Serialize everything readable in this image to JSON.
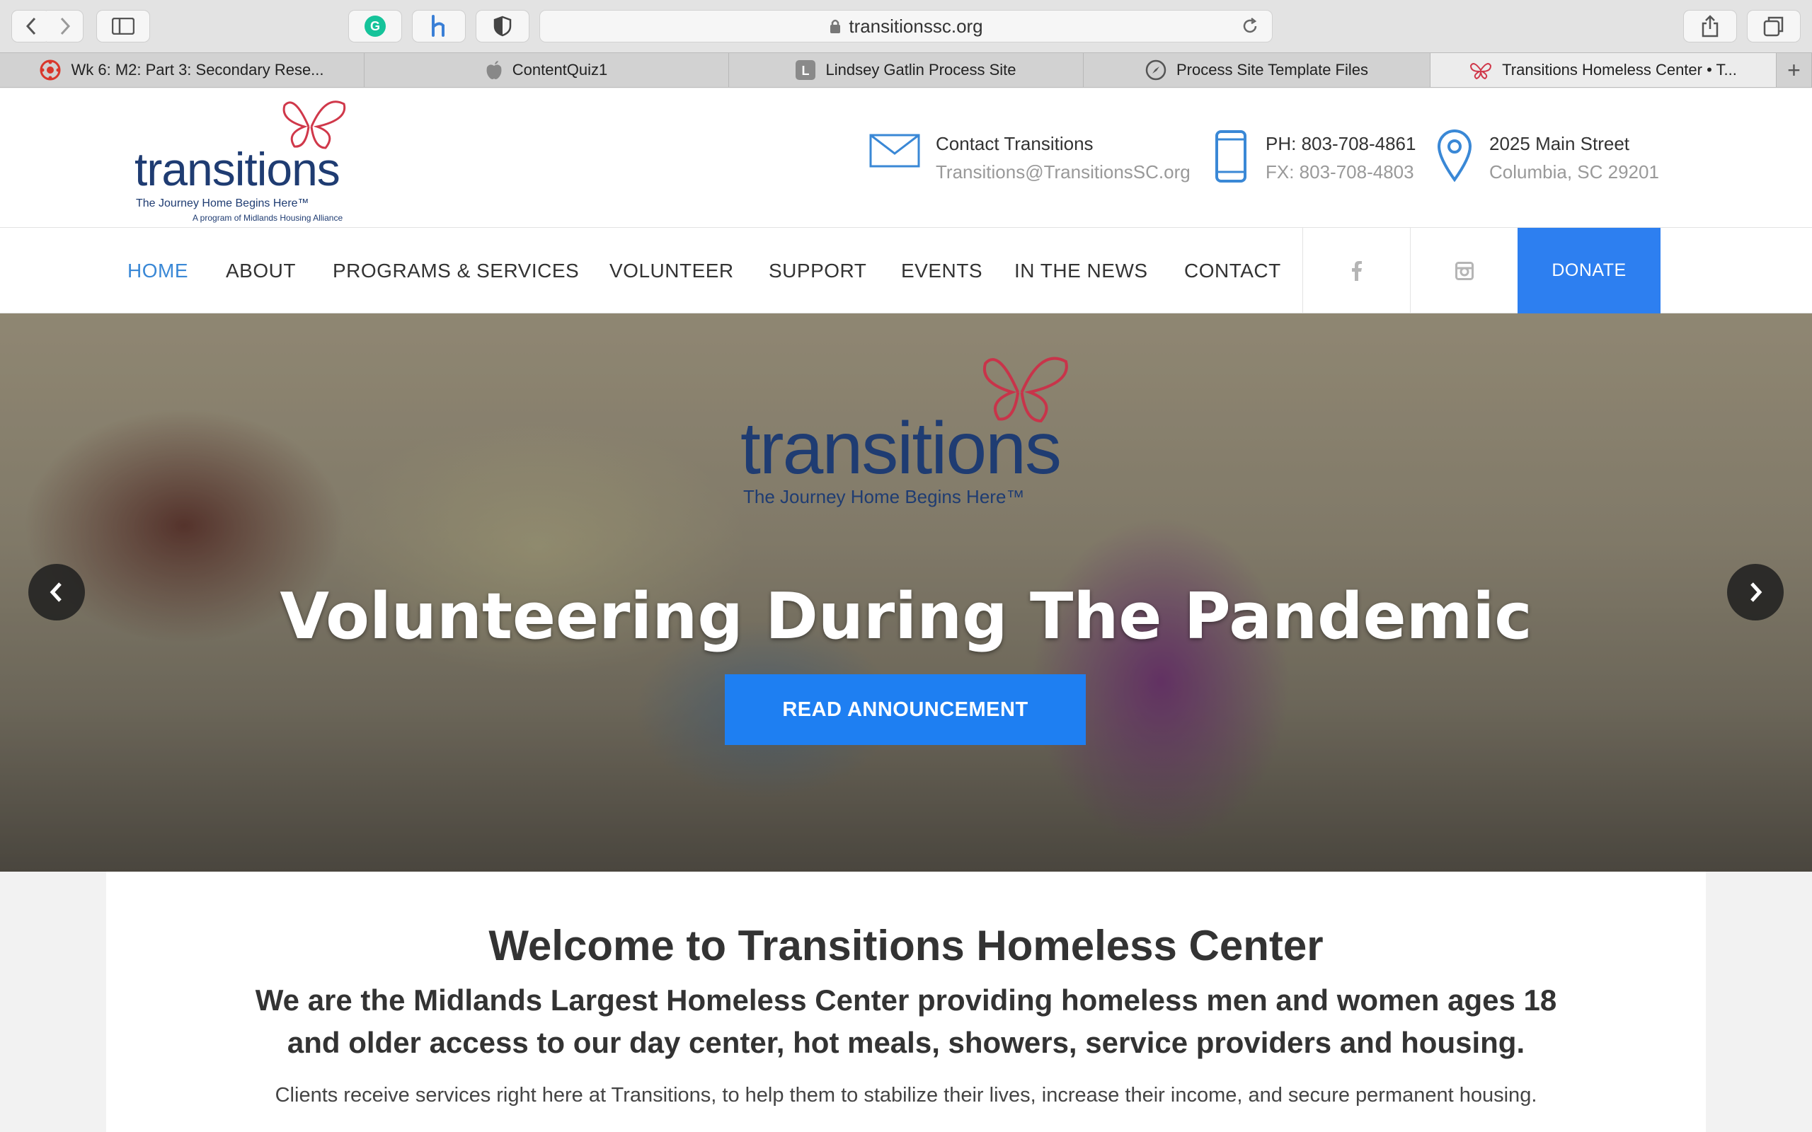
{
  "browser": {
    "url": "transitionssc.org",
    "tabs": [
      {
        "label": "Wk 6: M2: Part 3: Secondary Rese...",
        "icon": "canvas-icon",
        "active": false
      },
      {
        "label": "ContentQuiz1",
        "icon": "apple-icon",
        "active": false
      },
      {
        "label": "Lindsey Gatlin Process Site",
        "icon": "letter-l-icon",
        "active": false
      },
      {
        "label": "Process Site Template Files",
        "icon": "compass-icon",
        "active": false
      },
      {
        "label": "Transitions Homeless Center • T...",
        "icon": "butterfly-icon",
        "active": true
      }
    ]
  },
  "header": {
    "logo": {
      "word": "transitions",
      "tagline": "The Journey Home Begins Here™",
      "program": "A program of Midlands Housing Alliance"
    },
    "contact": {
      "line1": "Contact Transitions",
      "line2": "Transitions@TransitionsSC.org"
    },
    "phone": {
      "line1": "PH: 803-708-4861",
      "line2": "FX: 803-708-4803"
    },
    "address": {
      "line1": "2025 Main Street",
      "line2": "Columbia, SC 29201"
    }
  },
  "nav": {
    "items": [
      "HOME",
      "ABOUT",
      "PROGRAMS & SERVICES",
      "VOLUNTEER",
      "SUPPORT",
      "EVENTS",
      "IN THE NEWS",
      "CONTACT"
    ],
    "active": "HOME",
    "donate": "DONATE",
    "accent": "#3a88d6",
    "donate_color": "#2d7ff0"
  },
  "hero": {
    "logo_word": "transitions",
    "logo_tagline": "The Journey Home Begins Here™",
    "title": "Volunteering During The Pandemic",
    "button": "READ ANNOUNCEMENT",
    "button_color": "#1e7ff2"
  },
  "content": {
    "welcome": "Welcome to Transitions Homeless Center",
    "subtitle_line1": "We are the Midlands Largest Homeless Center providing homeless men and women ages 18",
    "subtitle_line2": "and older access to our day center, hot meals, showers, service providers and housing.",
    "paragraph": "Clients receive services right here at Transitions, to help them to stabilize their lives, increase their income, and secure permanent housing."
  }
}
